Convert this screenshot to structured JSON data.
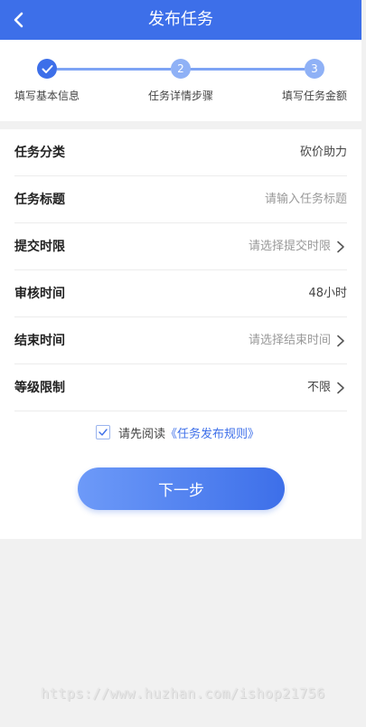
{
  "header": {
    "title": "发布任务",
    "back_icon": "chevron-left-icon"
  },
  "steps": [
    {
      "number": "",
      "label": "填写基本信息",
      "status": "done",
      "icon": "check-icon"
    },
    {
      "number": "2",
      "label": "任务详情步骤",
      "status": "todo"
    },
    {
      "number": "3",
      "label": "填写任务金额",
      "status": "todo"
    }
  ],
  "form": {
    "rows": [
      {
        "label": "任务分类",
        "value": "砍价助力",
        "is_placeholder": false,
        "has_arrow": false
      },
      {
        "label": "任务标题",
        "value": "请输入任务标题",
        "is_placeholder": true,
        "has_arrow": false
      },
      {
        "label": "提交时限",
        "value": "请选择提交时限",
        "is_placeholder": true,
        "has_arrow": true
      },
      {
        "label": "审核时间",
        "value": "48小时",
        "is_placeholder": false,
        "has_arrow": false
      },
      {
        "label": "结束时间",
        "value": "请选择结束时间",
        "is_placeholder": true,
        "has_arrow": true
      },
      {
        "label": "等级限制",
        "value": "不限",
        "is_placeholder": false,
        "has_arrow": true
      }
    ]
  },
  "agreement": {
    "checked": true,
    "prefix": "请先阅读",
    "link": "《任务发布规则》"
  },
  "next_button": {
    "label": "下一步"
  },
  "watermark": "https://www.huzhan.com/ishop21756",
  "colors": {
    "primary": "#3d6fe9",
    "step_todo": "#8fb1f6",
    "background": "#f1f1f1"
  }
}
